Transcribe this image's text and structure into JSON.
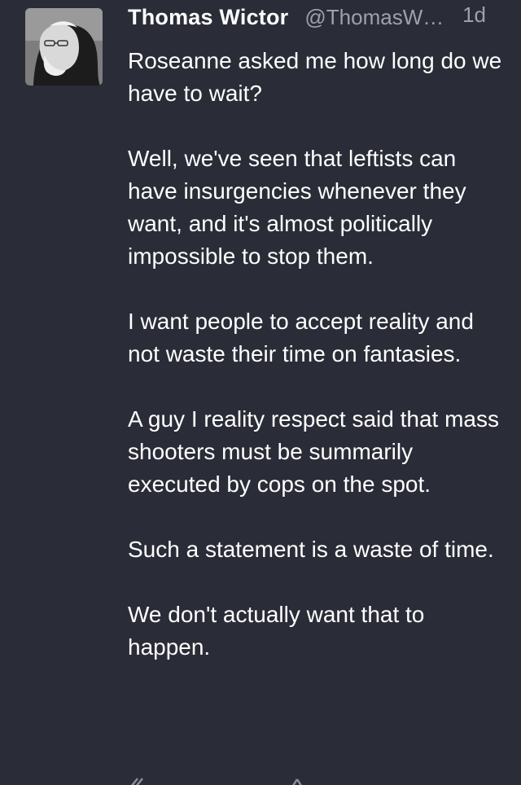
{
  "tweet": {
    "author": {
      "name": "Thomas Wictor",
      "handle": "@ThomasW…"
    },
    "time": "1d",
    "paragraphs": [
      "Roseanne asked me how long do we have to wait?",
      "Well, we've seen that leftists can have insurgencies whenever they want, and it's almost politically impossible to stop them.",
      "I want people to accept reality and not waste their time on fantasies.",
      "A guy I reality respect said that mass shooters must be summarily executed by cops on the spot.",
      "Such a statement is a waste of time.",
      "We don't actually want that to happen."
    ],
    "action_icons": [
      "reply-icon",
      "retweet-icon"
    ]
  }
}
